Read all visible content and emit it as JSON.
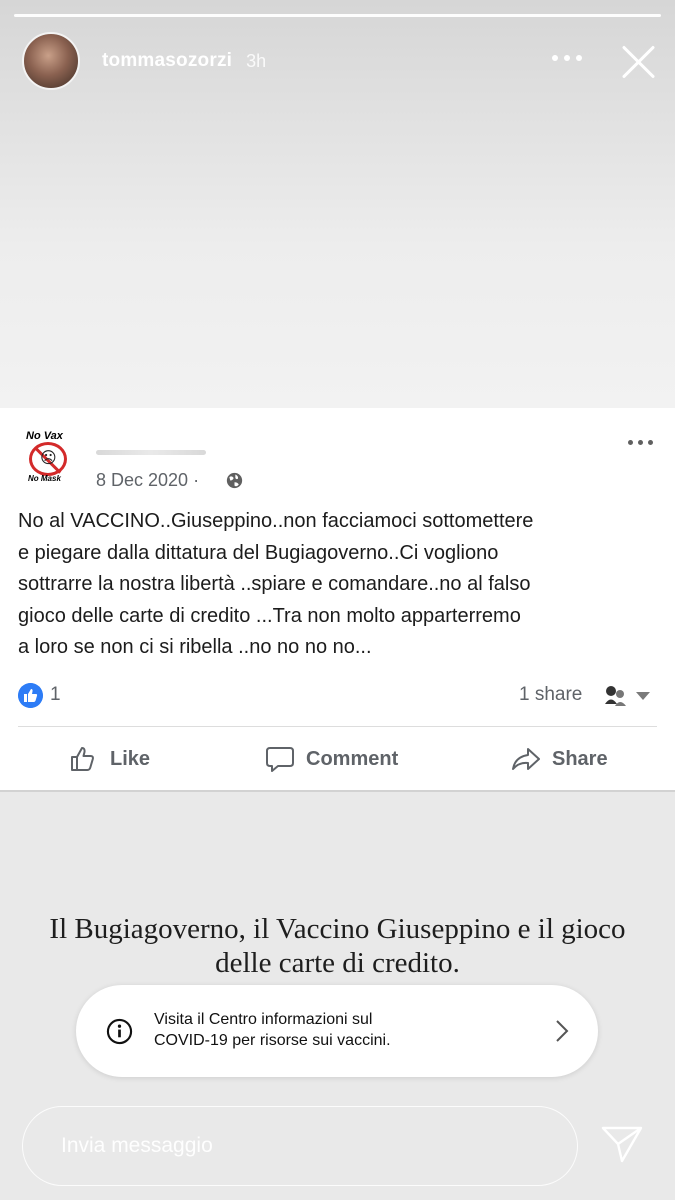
{
  "story": {
    "username": "tommasozorzi",
    "time": "3h"
  },
  "post": {
    "page_avatar": {
      "top_text": "No Vax",
      "bottom_text": "No Mask"
    },
    "date": "8 Dec 2020 ·",
    "text": "No al VACCINO..Giuseppino..non facciamoci sottomettere\ne piegare dalla dittatura del Bugiagoverno..Ci vogliono\nsottrarre la nostra libertà ..spiare e comandare..no al falso\ngioco delle carte di  credito ...Tra non molto apparterremo\na loro se non ci si ribella ..no no no no...",
    "like_count": "1",
    "share_count": "1 share",
    "actions": {
      "like": "Like",
      "comment": "Comment",
      "share": "Share"
    }
  },
  "article": {
    "title": "Il Bugiagoverno, il Vaccino Giuseppino e il gioco delle carte di credito."
  },
  "covid_banner": {
    "text": "Visita il Centro informazioni sul\nCOVID-19 per risorse sui vaccini."
  },
  "message": {
    "placeholder": "Invia messaggio"
  },
  "colors": {
    "like_blue": "#2d7cf6",
    "ban_red": "#d32a2a",
    "meta_gray": "#5f6368"
  }
}
